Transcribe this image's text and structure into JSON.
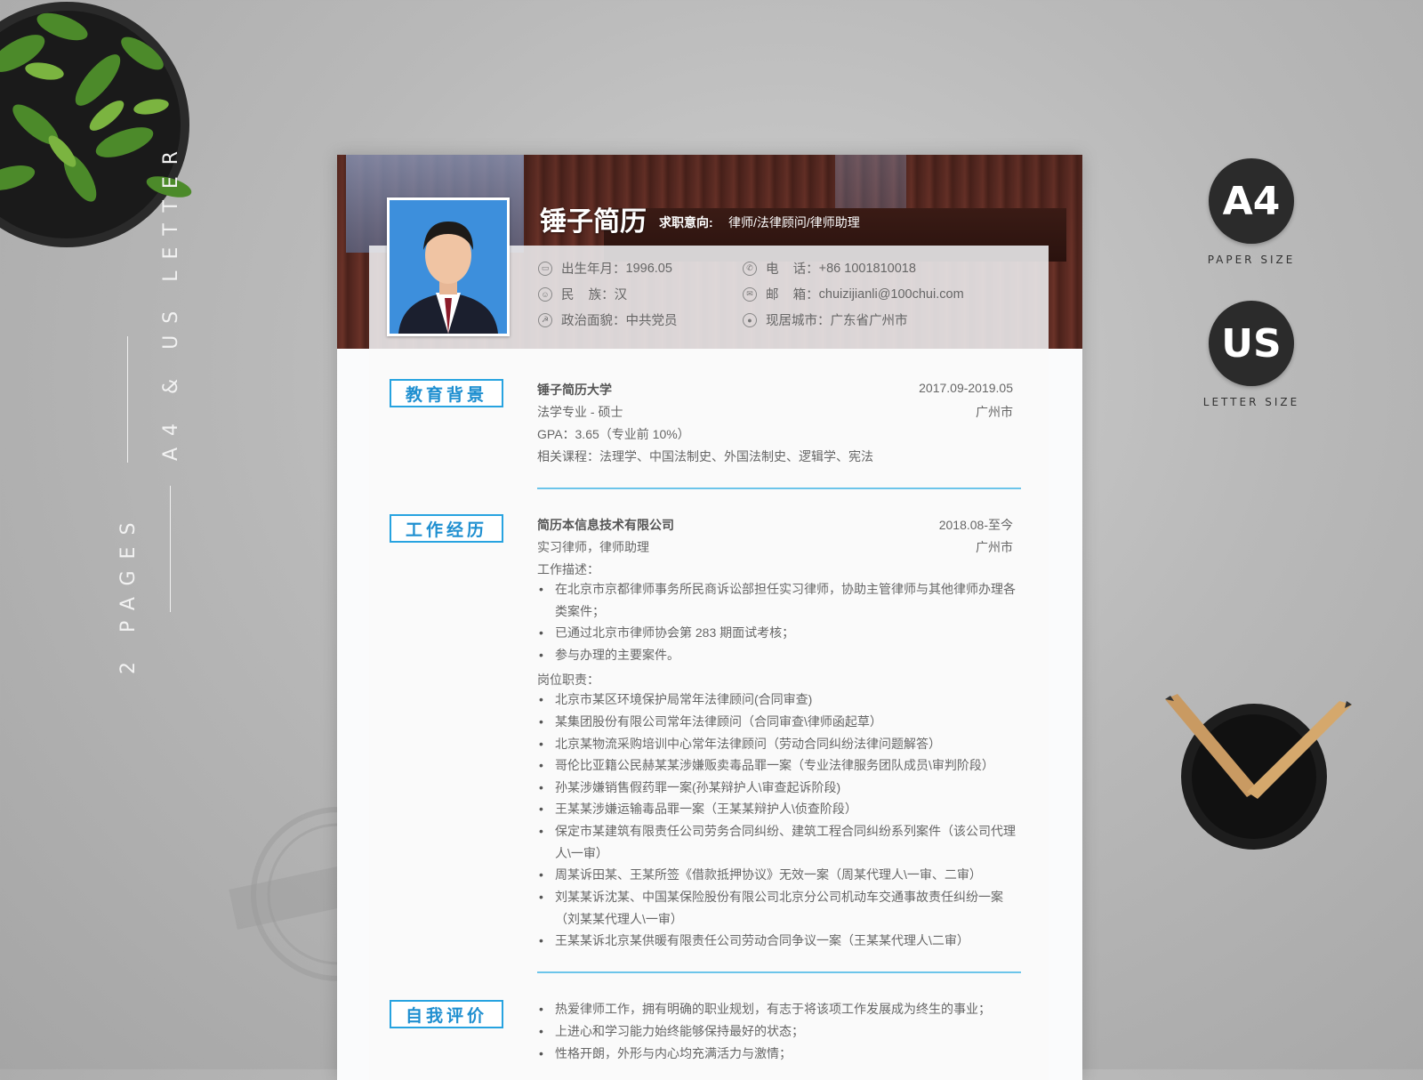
{
  "side": {
    "vertical_text_1": "A4 & US LETTER",
    "vertical_text_2": "2 PAGES"
  },
  "badges": [
    {
      "code": "A4",
      "caption": "PAPER SIZE"
    },
    {
      "code": "US",
      "caption": "LETTER SIZE"
    }
  ],
  "resume": {
    "name": "锤子简历",
    "intent_label": "求职意向:",
    "intent_value": "律师/法律顾问/律师助理",
    "info": [
      {
        "label": "出生年月",
        "value": "1996.05",
        "icon": "id-card-icon"
      },
      {
        "label": "电    话",
        "value": "+86 1001810018",
        "icon": "phone-icon"
      },
      {
        "label": "民    族",
        "value": "汉",
        "icon": "person-icon"
      },
      {
        "label": "邮    箱",
        "value": "chuizijianli@100chui.com",
        "icon": "mail-icon"
      },
      {
        "label": "政治面貌",
        "value": "中共党员",
        "icon": "party-icon"
      },
      {
        "label": "现居城市",
        "value": "广东省广州市",
        "icon": "location-icon"
      }
    ],
    "sections": {
      "education_title": "教育背景",
      "work_title": "工作经历",
      "self_title": "自我评价"
    },
    "education": {
      "school": "锤子简历大学",
      "period": "2017.09-2019.05",
      "major": "法学专业 - 硕士",
      "city": "广州市",
      "gpa": "GPA：3.65（专业前 10%）",
      "courses": "相关课程：法理学、中国法制史、外国法制史、逻辑学、宪法"
    },
    "work": {
      "company": "简历本信息技术有限公司",
      "period": "2018.08-至今",
      "role": "实习律师，律师助理",
      "city": "广州市",
      "desc_label": "工作描述：",
      "desc": [
        "在北京市京都律师事务所民商诉讼部担任实习律师，协助主管律师与其他律师办理各类案件；",
        "已通过北京市律师协会第 283 期面试考核；",
        "参与办理的主要案件。"
      ],
      "duty_label": "岗位职责：",
      "duties": [
        "北京市某区环境保护局常年法律顾问(合同审查)",
        "某集团股份有限公司常年法律顾问（合同审查\\律师函起草）",
        "北京某物流采购培训中心常年法律顾问（劳动合同纠纷法律问题解答）",
        "哥伦比亚籍公民赫某某涉嫌贩卖毒品罪一案（专业法律服务团队成员\\审判阶段）",
        "孙某涉嫌销售假药罪一案(孙某辩护人\\审查起诉阶段)",
        "王某某涉嫌运输毒品罪一案（王某某辩护人\\侦查阶段）",
        "保定市某建筑有限责任公司劳务合同纠纷、建筑工程合同纠纷系列案件（该公司代理人\\一审）",
        "周某诉田某、王某所签《借款抵押协议》无效一案（周某代理人\\一审、二审）",
        "刘某某诉沈某、中国某保险股份有限公司北京分公司机动车交通事故责任纠纷一案（刘某某代理人\\一审）",
        "王某某诉北京某供暖有限责任公司劳动合同争议一案（王某某代理人\\二审）"
      ]
    },
    "self": [
      "热爱律师工作，拥有明确的职业规划，有志于将该项工作发展成为终生的事业；",
      "上进心和学习能力始终能够保持最好的状态；",
      "性格开朗，外形与内心均充满活力与激情；"
    ]
  },
  "colors": {
    "accent": "#27a3e0",
    "badge_bg": "#2b2b2b",
    "banner": "#5b2a22"
  }
}
